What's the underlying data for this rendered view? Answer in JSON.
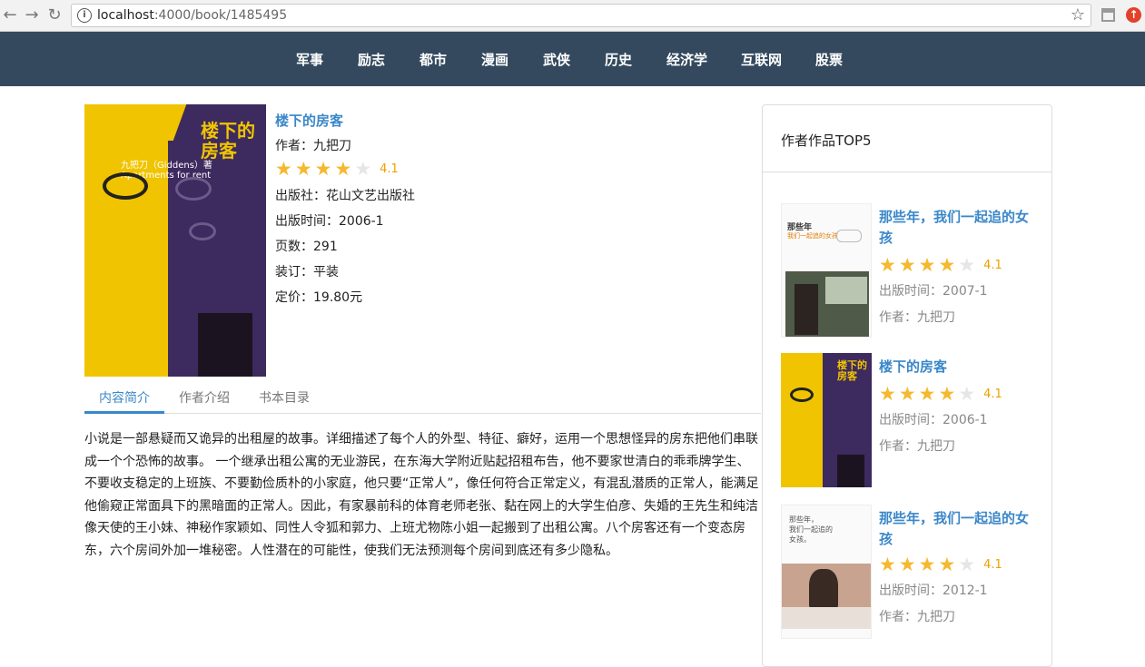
{
  "browser": {
    "url_host": "localhost",
    "url_path": ":4000/book/1485495"
  },
  "nav": {
    "items": [
      "军事",
      "励志",
      "都市",
      "漫画",
      "武侠",
      "历史",
      "经济学",
      "互联网",
      "股票"
    ]
  },
  "book": {
    "title": "楼下的房客",
    "cover_title": "楼下的房客",
    "cover_author": "九把刀（Giddens）著",
    "cover_subtitle": "Apartments for rent",
    "author": "作者：九把刀",
    "rating": "4.1",
    "rating_value": 4.1,
    "publisher": "出版社：花山文艺出版社",
    "pub_date": "出版时间：2006-1",
    "pages": "页数：291",
    "binding": "装订：平装",
    "price": "定价：19.80元"
  },
  "tabs": [
    "内容简介",
    "作者介绍",
    "书本目录"
  ],
  "description": "小说是一部悬疑而又诡异的出租屋的故事。详细描述了每个人的外型、特征、癖好，运用一个思想怪异的房东把他们串联成一个个恐怖的故事。 一个继承出租公寓的无业游民，在东海大学附近贴起招租布告，他不要家世清白的乖乖牌学生、不要收支稳定的上班族、不要勤俭质朴的小家庭，他只要“正常人”，像任何符合正常定义，有混乱潜质的正常人，能满足他偷窥正常面具下的黑暗面的正常人。因此，有家暴前科的体育老师老张、黏在网上的大学生伯彦、失婚的王先生和纯洁像天使的王小妹、神秘作家颖如、同性人令狐和郭力、上班尤物陈小姐一起搬到了出租公寓。八个房客还有一个变态房东，六个房间外加一堆秘密。人性潜在的可能性，使我们无法预测每个房间到底还有多少隐私。",
  "sidebar": {
    "title": "作者作品TOP5",
    "items": [
      {
        "title": "那些年，我们一起追的女孩",
        "rating": "4.1",
        "rating_value": 4.1,
        "pub_date": "出版时间：2007-1",
        "author": "作者：九把刀"
      },
      {
        "title": "楼下的房客",
        "rating": "4.1",
        "rating_value": 4.1,
        "pub_date": "出版时间：2006-1",
        "author": "作者：九把刀"
      },
      {
        "title": "那些年，我们一起追的女孩",
        "rating": "4.1",
        "rating_value": 4.1,
        "pub_date": "出版时间：2012-1",
        "author": "作者：九把刀"
      }
    ]
  },
  "colors": {
    "nav_bg": "#34495e",
    "link": "#3a87c9",
    "star": "#f5b82e"
  }
}
